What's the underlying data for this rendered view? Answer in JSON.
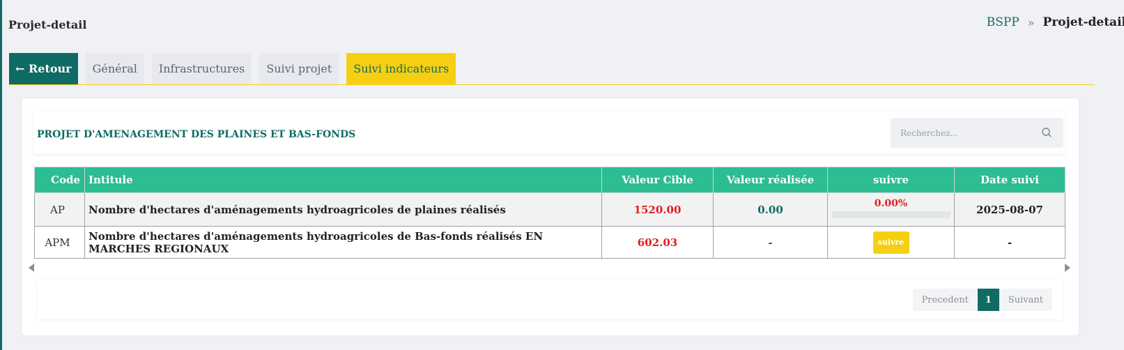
{
  "page": {
    "title": "Projet-detail",
    "breadcrumb": {
      "root": "BSPP",
      "separator": "»",
      "current": "Projet-detail"
    }
  },
  "tabs": [
    {
      "label": "← Retour"
    },
    {
      "label": "Général"
    },
    {
      "label": "Infrastructures"
    },
    {
      "label": "Suivi projet"
    },
    {
      "label": "Suivi indicateurs"
    }
  ],
  "project": {
    "title": "PROJET D'AMENAGEMENT DES PLAINES ET BAS-FONDS"
  },
  "search": {
    "placeholder": "Recherchez...",
    "value": ""
  },
  "table": {
    "headers": [
      "Code",
      "Intitule",
      "Valeur Cible",
      "Valeur réalisée",
      "suivre",
      "Date suivi"
    ],
    "rows": [
      {
        "code": "AP",
        "intitule": "Nombre d'hectares d'aménagements hydroagricoles de plaines réalisés",
        "valeur_cible": "1520.00",
        "valeur_realisee": "0.00",
        "suivre_pct": "0.00%",
        "progress": 0,
        "date_suivi": "2025-08-07"
      },
      {
        "code": "APM",
        "intitule": "Nombre d'hectares d'aménagements hydroagricoles de Bas-fonds réalisés EN MARCHES REGIONAUX",
        "valeur_cible": "602.03",
        "valeur_realisee": "-",
        "suivre_button": "suivre",
        "date_suivi": "-"
      }
    ]
  },
  "pagination": {
    "previous": "Precedent",
    "current_page": "1",
    "next": "Suivant"
  },
  "colors": {
    "primary": "#0f6b63",
    "accent": "#f7cf12",
    "table_header": "#2cbd93",
    "danger": "#e21c1c"
  }
}
